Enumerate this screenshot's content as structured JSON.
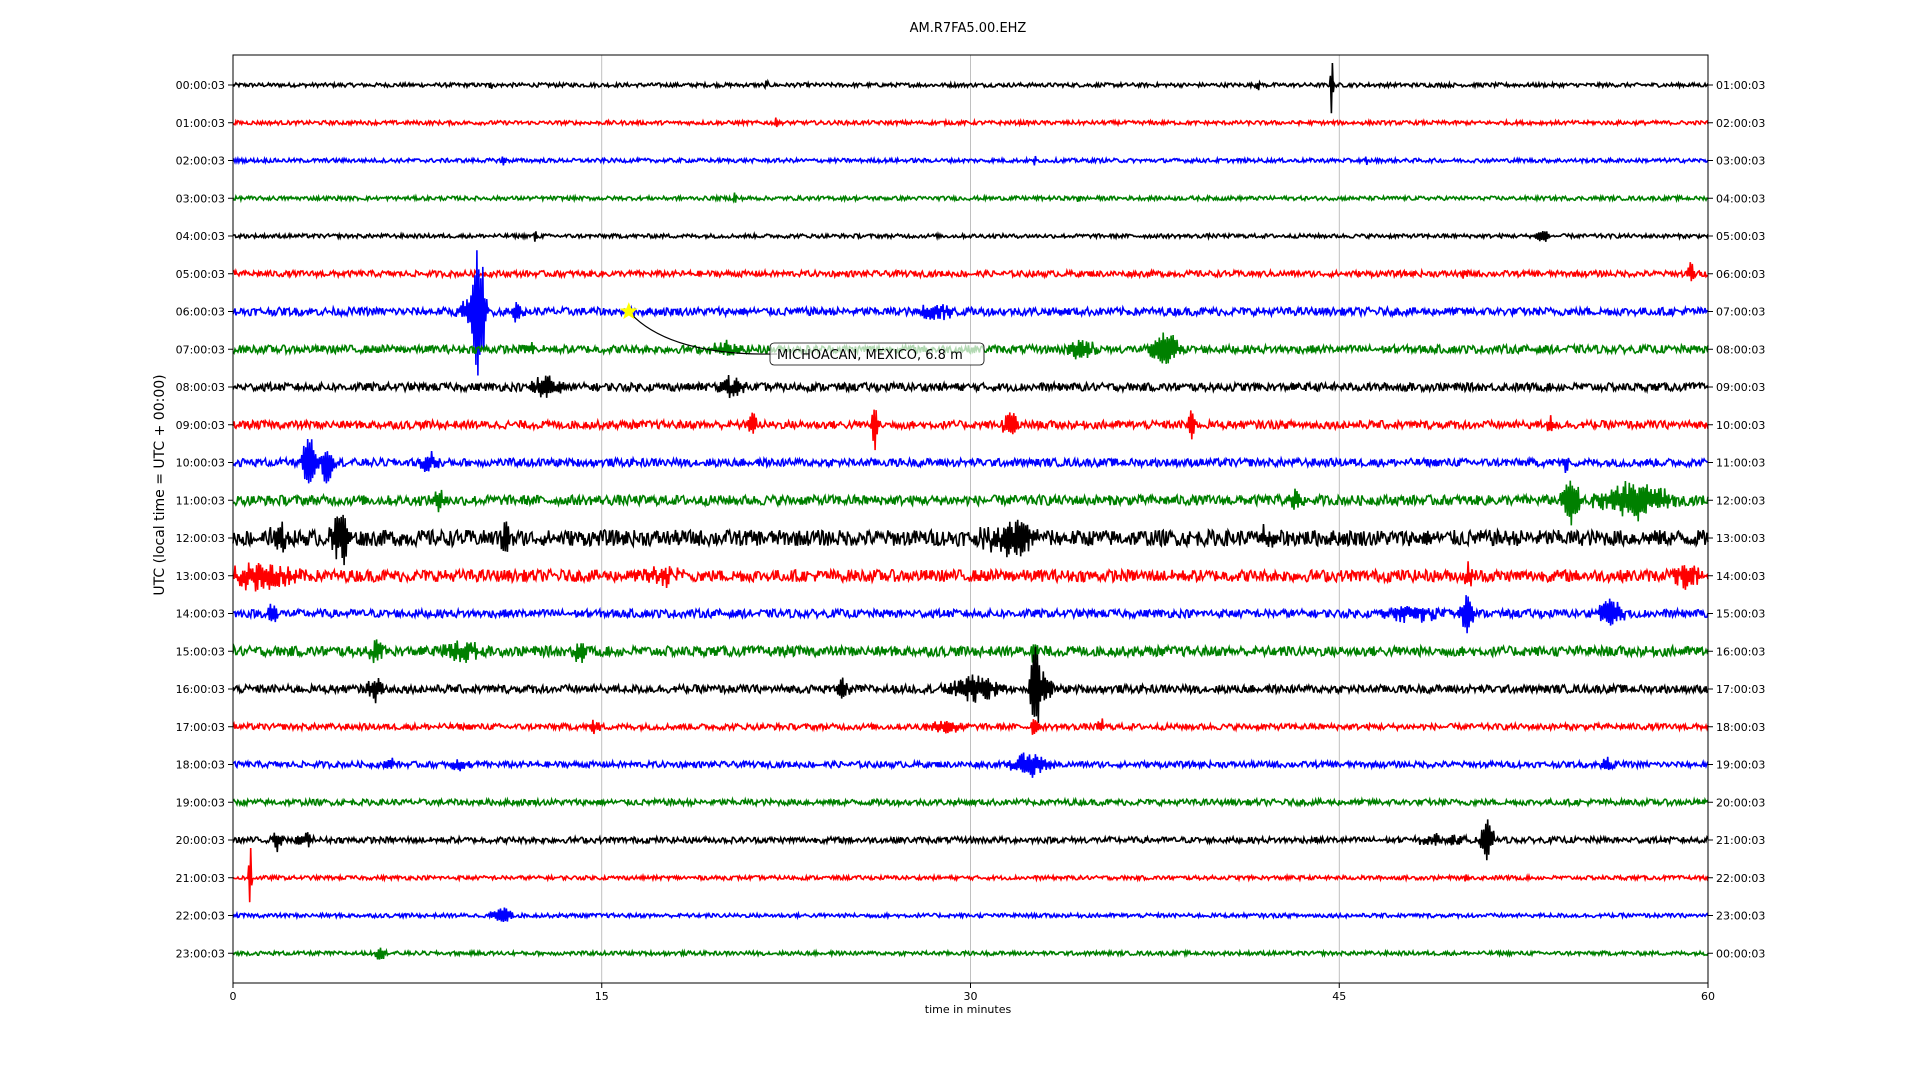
{
  "chart_data": {
    "type": "line",
    "title": "AM.R7FA5.00.EHZ",
    "xlabel": "time in minutes",
    "ylabel": "UTC (local time = UTC + 00:00)",
    "xlim": [
      0,
      60
    ],
    "x_ticks": [
      0,
      15,
      30,
      45,
      60
    ],
    "grid": "vertical",
    "trace_colors": [
      "#000000",
      "#ff0000",
      "#0000ff",
      "#008000"
    ],
    "rows": [
      {
        "left": "00:00:03",
        "right": "01:00:03",
        "noise": 2,
        "events": [
          {
            "t": 44.7,
            "amp": 45,
            "dur": 0.08
          },
          {
            "t": 10.5,
            "amp": 6,
            "dur": 0.1
          },
          {
            "t": 21.7,
            "amp": 5,
            "dur": 0.1
          },
          {
            "t": 41.7,
            "amp": 7,
            "dur": 0.1
          }
        ]
      },
      {
        "left": "01:00:03",
        "right": "02:00:03",
        "noise": 2,
        "events": [
          {
            "t": 5.2,
            "amp": 5,
            "dur": 0.1
          },
          {
            "t": 22.1,
            "amp": 5,
            "dur": 0.1
          }
        ]
      },
      {
        "left": "02:00:03",
        "right": "03:00:03",
        "noise": 2,
        "events": [
          {
            "t": 11.0,
            "amp": 6,
            "dur": 0.1
          },
          {
            "t": 32.6,
            "amp": 5,
            "dur": 0.1
          },
          {
            "t": 46.1,
            "amp": 4,
            "dur": 0.1
          }
        ]
      },
      {
        "left": "03:00:03",
        "right": "04:00:03",
        "noise": 2,
        "events": [
          {
            "t": 20.4,
            "amp": 7,
            "dur": 0.1
          },
          {
            "t": 34.4,
            "amp": 4,
            "dur": 0.1
          }
        ]
      },
      {
        "left": "04:00:03",
        "right": "05:00:03",
        "noise": 2,
        "events": [
          {
            "t": 12.3,
            "amp": 6,
            "dur": 0.1
          },
          {
            "t": 53.3,
            "amp": 7,
            "dur": 0.4
          }
        ]
      },
      {
        "left": "05:00:03",
        "right": "06:00:03",
        "noise": 3,
        "events": [
          {
            "t": 59.3,
            "amp": 12,
            "dur": 0.2
          },
          {
            "t": 50.1,
            "amp": 5,
            "dur": 0.2
          }
        ]
      },
      {
        "left": "06:00:03",
        "right": "07:00:03",
        "noise": 4,
        "events": [
          {
            "t": 10.0,
            "amp": 70,
            "dur": 0.4
          },
          {
            "t": 9.6,
            "amp": 14,
            "dur": 0.6
          },
          {
            "t": 28.6,
            "amp": 8,
            "dur": 1.0
          },
          {
            "t": 11.5,
            "amp": 8,
            "dur": 0.4
          }
        ]
      },
      {
        "left": "07:00:03",
        "right": "08:00:03",
        "noise": 4,
        "events": [
          {
            "t": 37.9,
            "amp": 20,
            "dur": 0.8
          },
          {
            "t": 34.5,
            "amp": 10,
            "dur": 0.8
          },
          {
            "t": 12.1,
            "amp": 8,
            "dur": 0.4
          },
          {
            "t": 20.0,
            "amp": 7,
            "dur": 0.8
          }
        ]
      },
      {
        "left": "08:00:03",
        "right": "09:00:03",
        "noise": 4,
        "events": [
          {
            "t": 12.7,
            "amp": 10,
            "dur": 1.0
          },
          {
            "t": 20.3,
            "amp": 10,
            "dur": 0.8
          }
        ]
      },
      {
        "left": "09:00:03",
        "right": "10:00:03",
        "noise": 4,
        "events": [
          {
            "t": 26.1,
            "amp": 24,
            "dur": 0.2
          },
          {
            "t": 21.1,
            "amp": 12,
            "dur": 0.3
          },
          {
            "t": 31.6,
            "amp": 14,
            "dur": 0.4
          },
          {
            "t": 39.0,
            "amp": 18,
            "dur": 0.2
          },
          {
            "t": 53.6,
            "amp": 12,
            "dur": 0.3
          }
        ]
      },
      {
        "left": "10:00:03",
        "right": "11:00:03",
        "noise": 4,
        "events": [
          {
            "t": 3.1,
            "amp": 30,
            "dur": 0.4
          },
          {
            "t": 3.8,
            "amp": 22,
            "dur": 0.4
          },
          {
            "t": 8.0,
            "amp": 10,
            "dur": 0.6
          },
          {
            "t": 54.2,
            "amp": 8,
            "dur": 0.3
          }
        ]
      },
      {
        "left": "11:00:03",
        "right": "12:00:03",
        "noise": 5,
        "events": [
          {
            "t": 54.4,
            "amp": 22,
            "dur": 0.6
          },
          {
            "t": 57.0,
            "amp": 20,
            "dur": 2.0
          },
          {
            "t": 8.4,
            "amp": 12,
            "dur": 0.3
          },
          {
            "t": 43.2,
            "amp": 10,
            "dur": 0.4
          }
        ]
      },
      {
        "left": "12:00:03",
        "right": "13:00:03",
        "noise": 8,
        "events": [
          {
            "t": 4.4,
            "amp": 28,
            "dur": 0.6
          },
          {
            "t": 1.9,
            "amp": 14,
            "dur": 0.5
          },
          {
            "t": 11.1,
            "amp": 14,
            "dur": 0.4
          },
          {
            "t": 31.6,
            "amp": 16,
            "dur": 1.5
          },
          {
            "t": 42.1,
            "amp": 14,
            "dur": 0.4
          }
        ]
      },
      {
        "left": "13:00:03",
        "right": "14:00:03",
        "noise": 6,
        "events": [
          {
            "t": 1.0,
            "amp": 14,
            "dur": 2.0
          },
          {
            "t": 50.3,
            "amp": 12,
            "dur": 0.3
          },
          {
            "t": 59.1,
            "amp": 10,
            "dur": 1.0
          },
          {
            "t": 17.5,
            "amp": 8,
            "dur": 1.0
          }
        ]
      },
      {
        "left": "14:00:03",
        "right": "15:00:03",
        "noise": 4,
        "events": [
          {
            "t": 50.2,
            "amp": 22,
            "dur": 0.4
          },
          {
            "t": 56.0,
            "amp": 16,
            "dur": 0.8
          },
          {
            "t": 1.6,
            "amp": 12,
            "dur": 0.3
          },
          {
            "t": 48.0,
            "amp": 8,
            "dur": 1.5
          }
        ]
      },
      {
        "left": "15:00:03",
        "right": "16:00:03",
        "noise": 5,
        "events": [
          {
            "t": 5.8,
            "amp": 12,
            "dur": 0.4
          },
          {
            "t": 9.3,
            "amp": 10,
            "dur": 1.0
          },
          {
            "t": 14.1,
            "amp": 10,
            "dur": 0.4
          },
          {
            "t": 32.6,
            "amp": 18,
            "dur": 0.2
          }
        ]
      },
      {
        "left": "16:00:03",
        "right": "17:00:03",
        "noise": 4,
        "events": [
          {
            "t": 32.6,
            "amp": 48,
            "dur": 0.3
          },
          {
            "t": 33.0,
            "amp": 22,
            "dur": 0.4
          },
          {
            "t": 30.2,
            "amp": 14,
            "dur": 1.5
          },
          {
            "t": 5.8,
            "amp": 12,
            "dur": 0.5
          },
          {
            "t": 24.8,
            "amp": 10,
            "dur": 0.4
          }
        ]
      },
      {
        "left": "17:00:03",
        "right": "18:00:03",
        "noise": 3,
        "events": [
          {
            "t": 32.6,
            "amp": 12,
            "dur": 0.2
          },
          {
            "t": 35.3,
            "amp": 10,
            "dur": 0.2
          },
          {
            "t": 29.0,
            "amp": 6,
            "dur": 1.0
          },
          {
            "t": 14.7,
            "amp": 6,
            "dur": 0.3
          }
        ]
      },
      {
        "left": "18:00:03",
        "right": "19:00:03",
        "noise": 3,
        "events": [
          {
            "t": 32.4,
            "amp": 12,
            "dur": 1.2
          },
          {
            "t": 6.4,
            "amp": 8,
            "dur": 0.3
          },
          {
            "t": 9.2,
            "amp": 6,
            "dur": 0.5
          },
          {
            "t": 55.9,
            "amp": 6,
            "dur": 0.4
          }
        ]
      },
      {
        "left": "19:00:03",
        "right": "20:00:03",
        "noise": 3,
        "events": []
      },
      {
        "left": "20:00:03",
        "right": "21:00:03",
        "noise": 3,
        "events": [
          {
            "t": 51.0,
            "amp": 22,
            "dur": 0.4
          },
          {
            "t": 1.8,
            "amp": 10,
            "dur": 0.3
          },
          {
            "t": 2.9,
            "amp": 8,
            "dur": 0.5
          },
          {
            "t": 49.0,
            "amp": 5,
            "dur": 1.5
          }
        ]
      },
      {
        "left": "21:00:03",
        "right": "22:00:03",
        "noise": 2,
        "events": [
          {
            "t": 0.7,
            "amp": 48,
            "dur": 0.08
          },
          {
            "t": 50.2,
            "amp": 4,
            "dur": 0.3
          }
        ]
      },
      {
        "left": "22:00:03",
        "right": "23:00:03",
        "noise": 2,
        "events": [
          {
            "t": 10.9,
            "amp": 10,
            "dur": 0.6
          }
        ]
      },
      {
        "left": "23:00:03",
        "right": "00:00:03",
        "noise": 2,
        "events": [
          {
            "t": 6.0,
            "amp": 8,
            "dur": 0.3
          }
        ]
      }
    ],
    "annotation": {
      "row": 6,
      "t": 16.1,
      "text": "MICHOACAN, MEXICO, 6.8 m",
      "marker_color": "#ffff00"
    }
  }
}
